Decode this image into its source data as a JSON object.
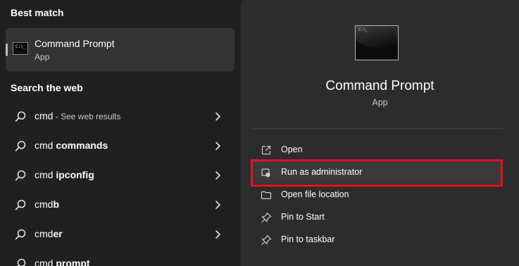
{
  "best_match": {
    "heading": "Best match",
    "app_name": "Command Prompt",
    "app_type": "App",
    "icon": "command-prompt-icon"
  },
  "web": {
    "heading": "Search the web",
    "results": [
      {
        "prefix": "cmd",
        "bold": "",
        "hint": " - See web results"
      },
      {
        "prefix": "cmd ",
        "bold": "commands",
        "hint": ""
      },
      {
        "prefix": "cmd ",
        "bold": "ipconfig",
        "hint": ""
      },
      {
        "prefix": "cmd",
        "bold": "b",
        "hint": ""
      },
      {
        "prefix": "cmd",
        "bold": "er",
        "hint": ""
      },
      {
        "prefix": "cmd ",
        "bold": "prompt",
        "hint": ""
      }
    ]
  },
  "detail": {
    "app_name": "Command Prompt",
    "app_type": "App",
    "actions": [
      {
        "label": "Open",
        "icon": "open-external-icon"
      },
      {
        "label": "Run as administrator",
        "icon": "shield-admin-icon",
        "highlighted": true
      },
      {
        "label": "Open file location",
        "icon": "folder-icon"
      },
      {
        "label": "Pin to Start",
        "icon": "pin-icon"
      },
      {
        "label": "Pin to taskbar",
        "icon": "pin-icon"
      }
    ]
  },
  "colors": {
    "background": "#202020",
    "panel": "#2c2c2c",
    "highlight_border": "#e0141e"
  }
}
